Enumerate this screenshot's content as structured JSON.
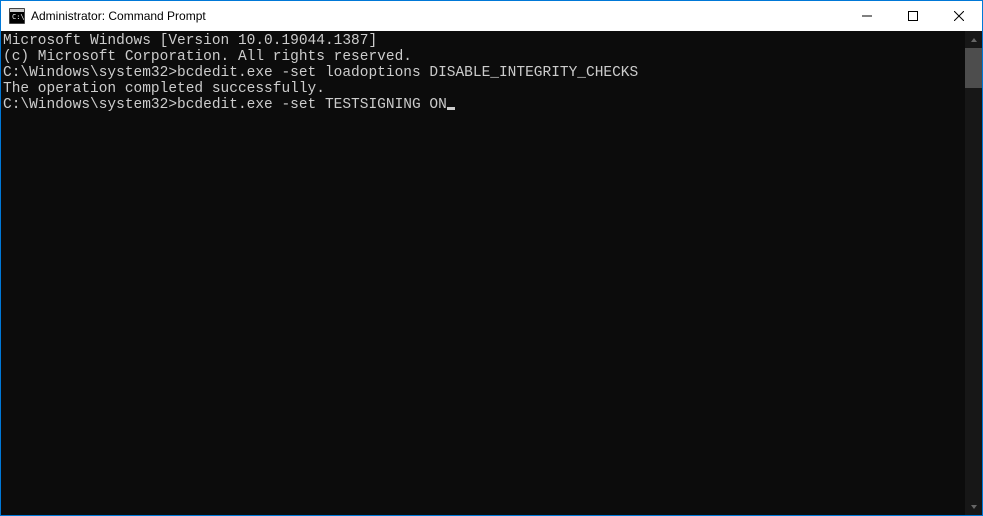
{
  "titlebar": {
    "title": "Administrator: Command Prompt"
  },
  "terminal": {
    "header1": "Microsoft Windows [Version 10.0.19044.1387]",
    "header2": "(c) Microsoft Corporation. All rights reserved.",
    "blank1": "",
    "prompt1": "C:\\Windows\\system32>",
    "command1": "bcdedit.exe -set loadoptions DISABLE_INTEGRITY_CHECKS",
    "output1": "The operation completed successfully.",
    "blank2": "",
    "prompt2": "C:\\Windows\\system32>",
    "command2": "bcdedit.exe -set TESTSIGNING ON"
  }
}
